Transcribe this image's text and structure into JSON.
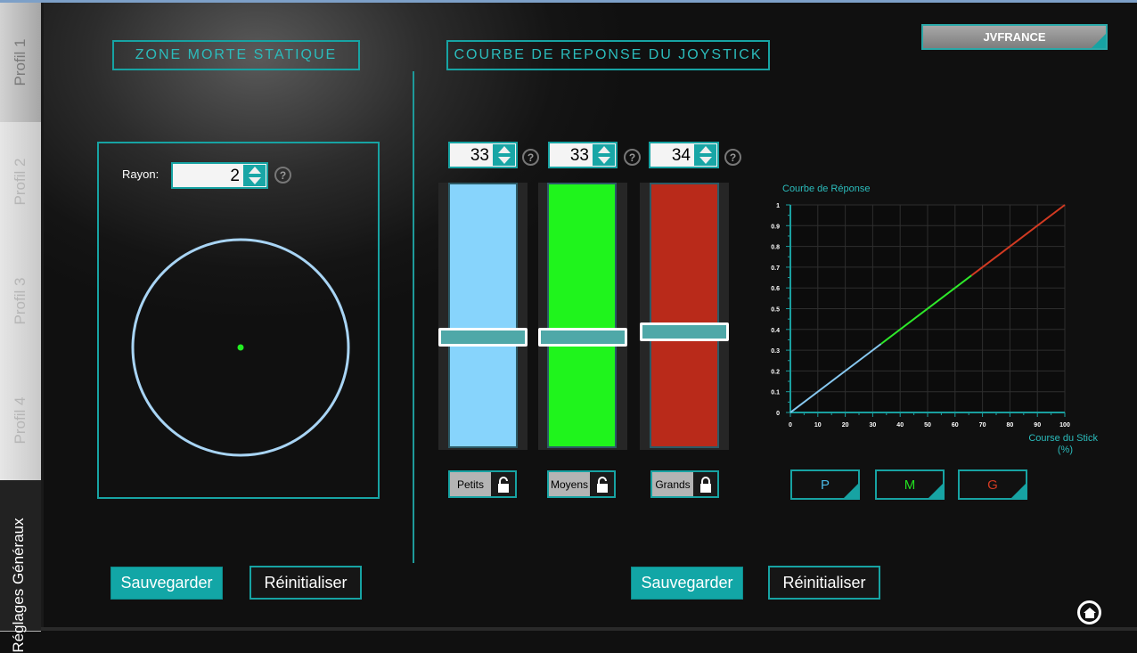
{
  "sidebar": {
    "items": [
      {
        "label": "Profil 1",
        "active": true
      },
      {
        "label": "Profil 2",
        "active": false
      },
      {
        "label": "Profil 3",
        "active": false
      },
      {
        "label": "Profil 4",
        "active": false
      },
      {
        "label": "Réglages Généraux",
        "active": false
      }
    ]
  },
  "header": {
    "brand_label": "JVFRANCE"
  },
  "deadzone": {
    "title": "ZONE MORTE STATIQUE",
    "radius_label": "Rayon:",
    "radius_value": "2",
    "help": "?",
    "save_label": "Sauvegarder",
    "reset_label": "Réinitialiser"
  },
  "curve": {
    "title": "COURBE DE REPONSE DU JOYSTICK",
    "help": "?",
    "sliders": [
      {
        "value": "33",
        "color": "#87d4fc",
        "label": "Petits",
        "locked": false,
        "level": 0.42
      },
      {
        "value": "33",
        "color": "#1ff41c",
        "label": "Moyens",
        "locked": false,
        "level": 0.42
      },
      {
        "value": "34",
        "color": "#b92a1a",
        "label": "Grands",
        "locked": true,
        "level": 0.44
      }
    ],
    "buttons": [
      {
        "label": "P",
        "color": "#4ab9e6"
      },
      {
        "label": "M",
        "color": "#22e01f"
      },
      {
        "label": "G",
        "color": "#d23a22"
      }
    ],
    "save_label": "Sauvegarder",
    "reset_label": "Réinitialiser"
  },
  "chart_data": {
    "type": "line",
    "title": "Courbe de Réponse",
    "xlabel": "Course du Stick",
    "xlabel_unit": "(%)",
    "xlim": [
      0,
      100
    ],
    "ylim": [
      0,
      1
    ],
    "x_ticks": [
      "0",
      "10",
      "20",
      "30",
      "40",
      "50",
      "60",
      "70",
      "80",
      "90",
      "100"
    ],
    "y_ticks": [
      "0",
      "0.1",
      "0.2",
      "0.3",
      "0.4",
      "0.5",
      "0.6",
      "0.7",
      "0.8",
      "0.9",
      "1"
    ],
    "grid": true,
    "series": [
      {
        "color": "#87c8f0",
        "x": [
          0,
          33
        ],
        "y": [
          0,
          0.33
        ]
      },
      {
        "color": "#2ee82a",
        "x": [
          33,
          66
        ],
        "y": [
          0.33,
          0.66
        ]
      },
      {
        "color": "#d23a22",
        "x": [
          66,
          100
        ],
        "y": [
          0.66,
          1
        ]
      }
    ]
  }
}
